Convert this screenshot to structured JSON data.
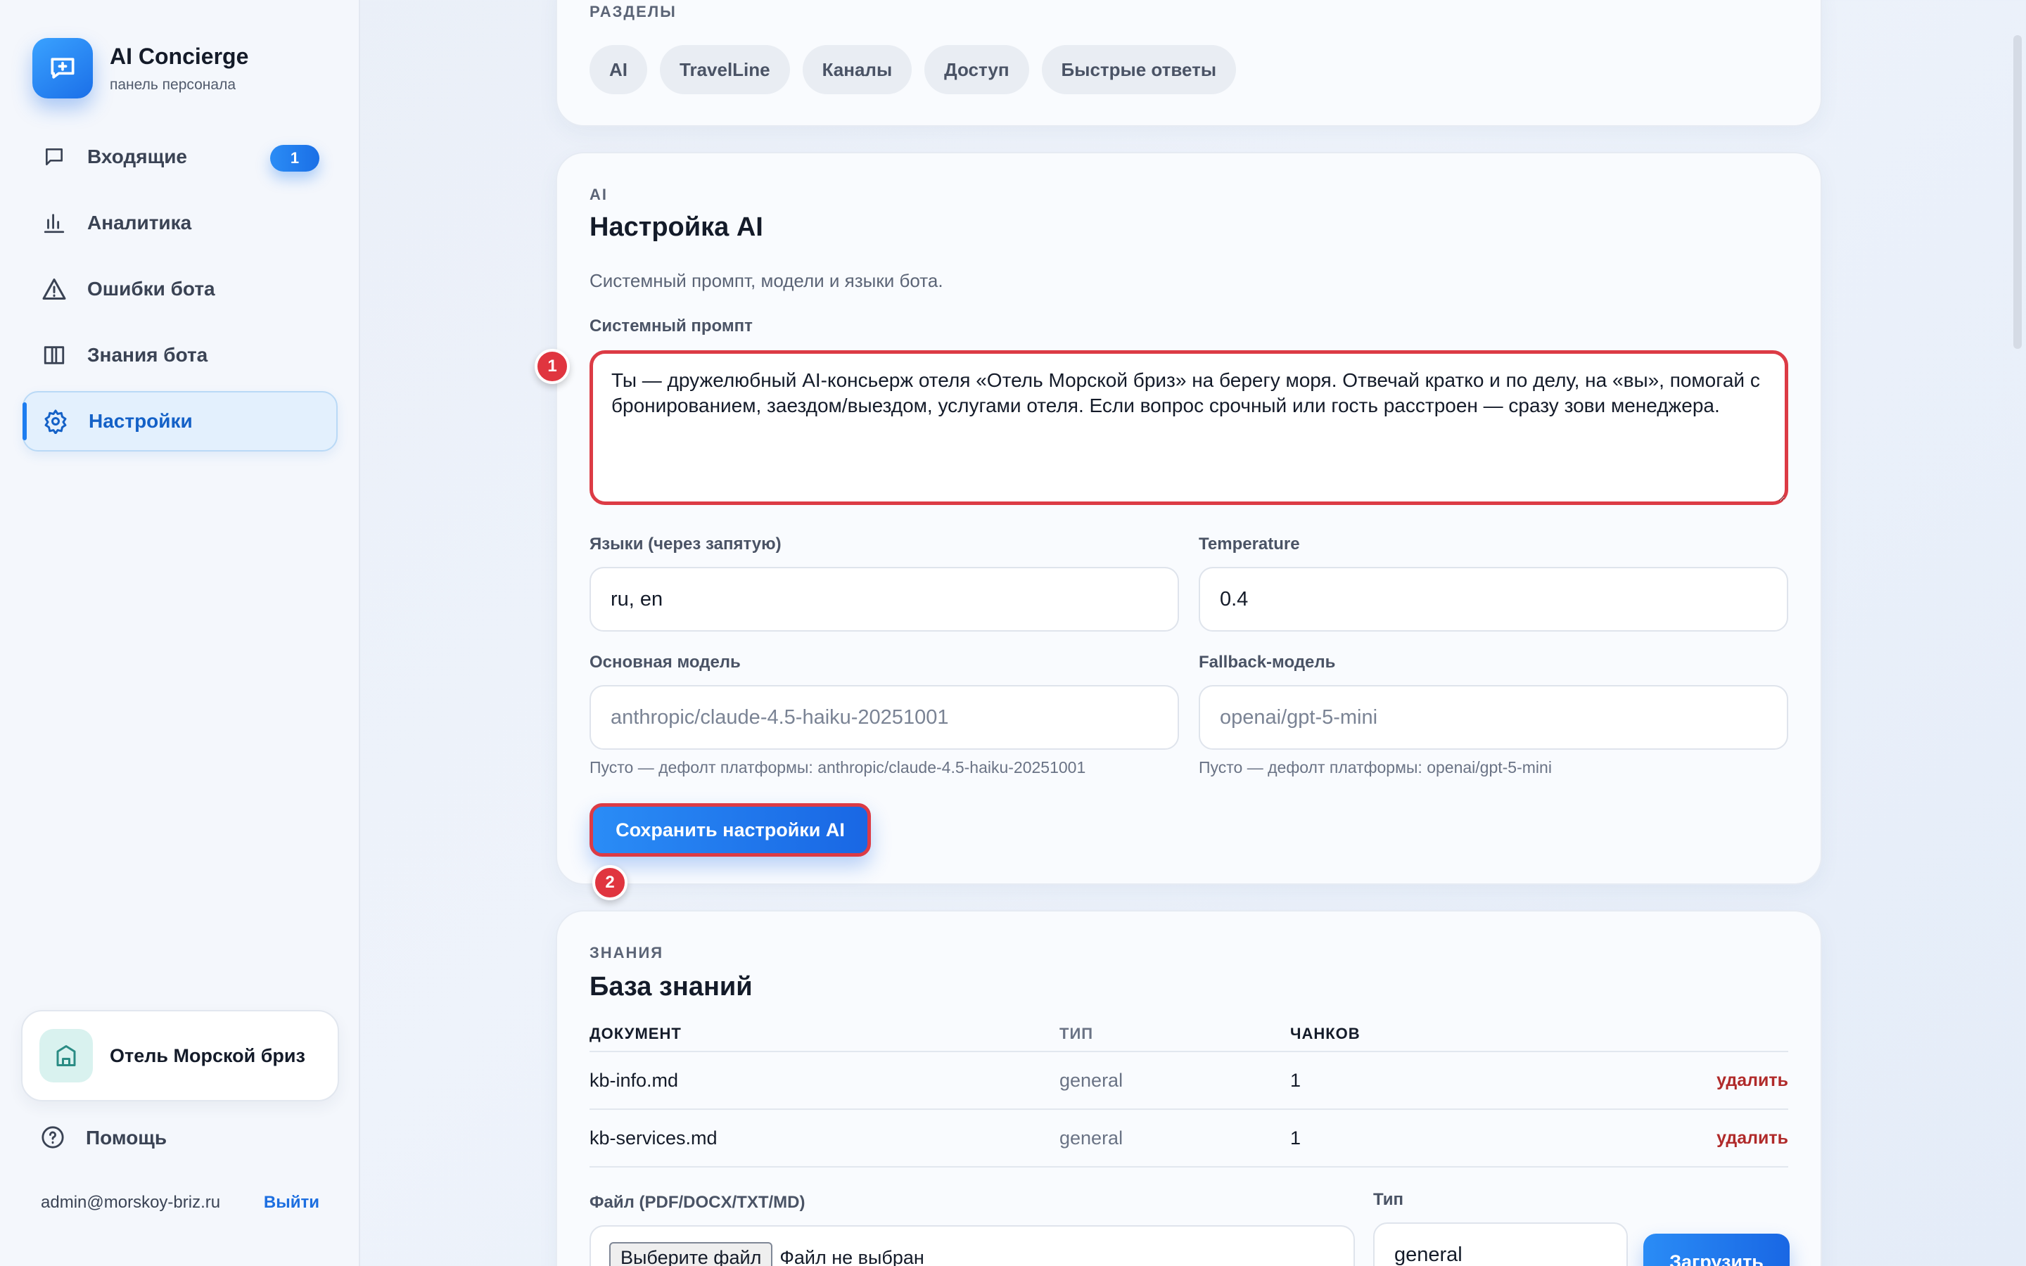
{
  "brand": {
    "title": "AI Concierge",
    "subtitle": "панель персонала"
  },
  "nav": {
    "items": [
      {
        "label": "Входящие",
        "icon": "chat-bubble-icon",
        "badge": "1"
      },
      {
        "label": "Аналитика",
        "icon": "bar-chart-icon"
      },
      {
        "label": "Ошибки бота",
        "icon": "warning-triangle-icon"
      },
      {
        "label": "Знания бота",
        "icon": "book-icon"
      },
      {
        "label": "Настройки",
        "icon": "gear-icon",
        "active": true
      }
    ]
  },
  "hotel": {
    "name": "Отель Морской бриз",
    "icon": "building-icon"
  },
  "help": {
    "label": "Помощь",
    "icon": "question-circle-icon"
  },
  "user": {
    "email": "admin@morskoy-briz.ru",
    "logout": "Выйти"
  },
  "sections": {
    "eyebrow": "РАЗДЕЛЫ",
    "chips": [
      "AI",
      "TravelLine",
      "Каналы",
      "Доступ",
      "Быстрые ответы"
    ]
  },
  "ai": {
    "eyebrow": "AI",
    "title": "Настройка AI",
    "description": "Системный промпт, модели и языки бота.",
    "prompt_label": "Системный промпт",
    "prompt_value": "Ты — дружелюбный AI-консьерж отеля «Отель Морской бриз» на берегу моря. Отвечай кратко и по делу, на «вы», помогай с бронированием, заездом/выездом, услугами отеля. Если вопрос срочный или гость расстроен — сразу зови менеджера.",
    "languages_label": "Языки (через запятую)",
    "languages_value": "ru, en",
    "temperature_label": "Temperature",
    "temperature_value": "0.4",
    "main_model_label": "Основная модель",
    "main_model_placeholder": "anthropic/claude-4.5-haiku-20251001",
    "main_model_hint": "Пусто — дефолт платформы: anthropic/claude-4.5-haiku-20251001",
    "fallback_label": "Fallback-модель",
    "fallback_placeholder": "openai/gpt-5-mini",
    "fallback_hint": "Пусто — дефолт платформы: openai/gpt-5-mini",
    "save_label": "Сохранить настройки AI",
    "marker_1": "1",
    "marker_2": "2"
  },
  "kb": {
    "eyebrow": "ЗНАНИЯ",
    "title": "База знаний",
    "columns": [
      "ДОКУМЕНТ",
      "ТИП",
      "ЧАНКОВ"
    ],
    "rows": [
      {
        "doc": "kb-info.md",
        "type": "general",
        "chunks": "1",
        "action": "удалить"
      },
      {
        "doc": "kb-services.md",
        "type": "general",
        "chunks": "1",
        "action": "удалить"
      }
    ],
    "file_label": "Файл (PDF/DOCX/TXT/MD)",
    "file_button": "Выберите файл",
    "file_status": "Файл не выбран",
    "type_label": "Тип",
    "type_value": "general",
    "upload_label": "Загрузить"
  }
}
